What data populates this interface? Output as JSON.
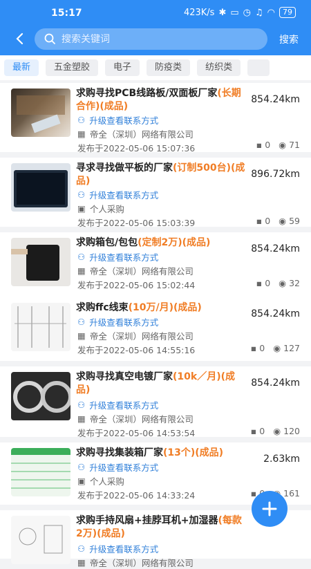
{
  "status_bar": {
    "time": "15:17",
    "network_speed": "423K/s",
    "battery": "79"
  },
  "search": {
    "placeholder": "搜索关键词",
    "button_label": "搜索"
  },
  "categories": [
    "最新",
    "五金塑胶",
    "电子",
    "防疫类",
    "纺织类"
  ],
  "upgrade_label": "升级查看联系方式",
  "listings": [
    {
      "title_plain": "求购寻找PCB线路板/双面板厂家",
      "title_hl": "(长期合作)(成品)",
      "distance": "854.24km",
      "company": "帝全（深圳）网络有限公司",
      "date": "发布于2022-05-06 15:07:36",
      "comments": "0",
      "views": "71"
    },
    {
      "title_plain": "寻求寻找做平板的厂家",
      "title_hl": "(订制500台)(成品)",
      "distance": "896.72km",
      "company": "个人采购",
      "date": "发布于2022-05-06 15:03:39",
      "comments": "0",
      "views": "59"
    },
    {
      "title_plain": "求购箱包/包包",
      "title_hl": "(定制2万)(成品)",
      "distance": "854.24km",
      "company": "帝全（深圳）网络有限公司",
      "date": "发布于2022-05-06 15:02:44",
      "comments": "0",
      "views": "32"
    },
    {
      "title_plain": "求购ffc线束",
      "title_hl": "(10万/月)(成品)",
      "distance": "854.24km",
      "company": "帝全（深圳）网络有限公司",
      "date": "发布于2022-05-06 14:55:16",
      "comments": "0",
      "views": "127"
    },
    {
      "title_plain": "求购寻找真空电镀厂家",
      "title_hl": "(10k／月)(成品)",
      "distance": "854.24km",
      "company": "帝全（深圳）网络有限公司",
      "date": "发布于2022-05-06 14:53:54",
      "comments": "0",
      "views": "120"
    },
    {
      "title_plain": "求购寻找集装箱厂家",
      "title_hl": "(13个)(成品)",
      "distance": "2.63km",
      "company": "个人采购",
      "date": "发布于2022-05-06 14:33:24",
      "comments": "0",
      "views": "161"
    },
    {
      "title_plain": "求购手持风扇+挂脖耳机+加湿器",
      "title_hl": "(每款2万)(成品)",
      "distance": "",
      "company": "帝全（深圳）网络有限公司",
      "date": "",
      "comments": "",
      "views": ""
    }
  ],
  "colors": {
    "primary": "#2f8df5",
    "highlight": "#f07d25",
    "link": "#2f7fd9"
  }
}
